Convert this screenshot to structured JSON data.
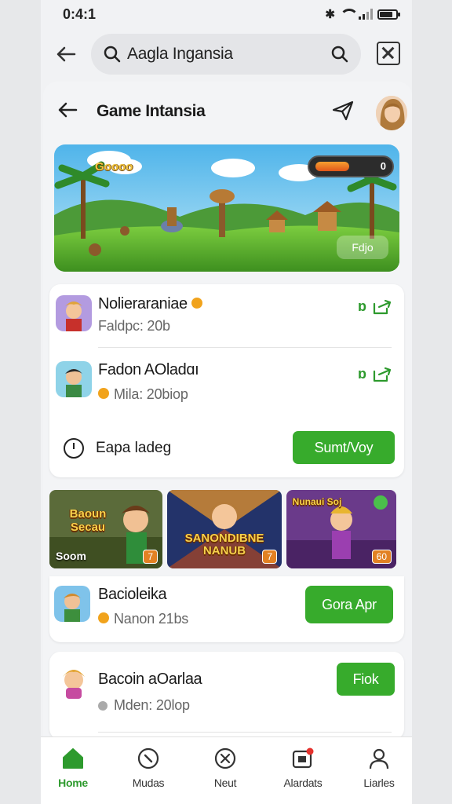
{
  "status_bar": {
    "time": "0:4:1"
  },
  "search": {
    "query": "Aagla Ingansia"
  },
  "sheet": {
    "title": "Game Intansia"
  },
  "banner": {
    "score_text": "Goooo",
    "bar_label": "",
    "bar_value_pct": 62,
    "corner_badge": "0",
    "button_label": "Fdjo"
  },
  "list_card": {
    "apps": [
      {
        "name": "Nolieraraniae",
        "sub": "Faldpc: 20b",
        "action_label": "ɒ"
      },
      {
        "name": "Fadon AOladɑı",
        "sub": "Mila: 20biop",
        "action_label": "ɒ"
      }
    ],
    "footer_label": "Eapa ladeg",
    "footer_button": "Sumt/Voy"
  },
  "promo": {
    "tiles": [
      {
        "title": "Baoun Secau",
        "caption": "Soom",
        "tag": "7"
      },
      {
        "title": "SANONDIBNE NANUB",
        "caption": "",
        "tag": "7"
      },
      {
        "title": "Nunaui Soj",
        "caption": "",
        "tag": "60"
      }
    ],
    "app": {
      "name": "Bacioleika",
      "sub": "Nanon 21bs"
    },
    "button": "Gora Apr"
  },
  "bottom_card": {
    "app": {
      "name": "Bacoin aOarlaa",
      "sub": "Mden: 20lop"
    },
    "button": "Fiok"
  },
  "nav": {
    "items": [
      {
        "label": "Home",
        "icon": "home-icon",
        "active": true
      },
      {
        "label": "Mudas",
        "icon": "compass-icon"
      },
      {
        "label": "Neut",
        "icon": "cross-circle-icon"
      },
      {
        "label": "Alardats",
        "icon": "notification-icon"
      },
      {
        "label": "Liarles",
        "icon": "profile-icon"
      }
    ]
  },
  "colors": {
    "accent_green": "#37ab2c",
    "text": "#1a1a1a",
    "background": "#f1f2f4"
  }
}
